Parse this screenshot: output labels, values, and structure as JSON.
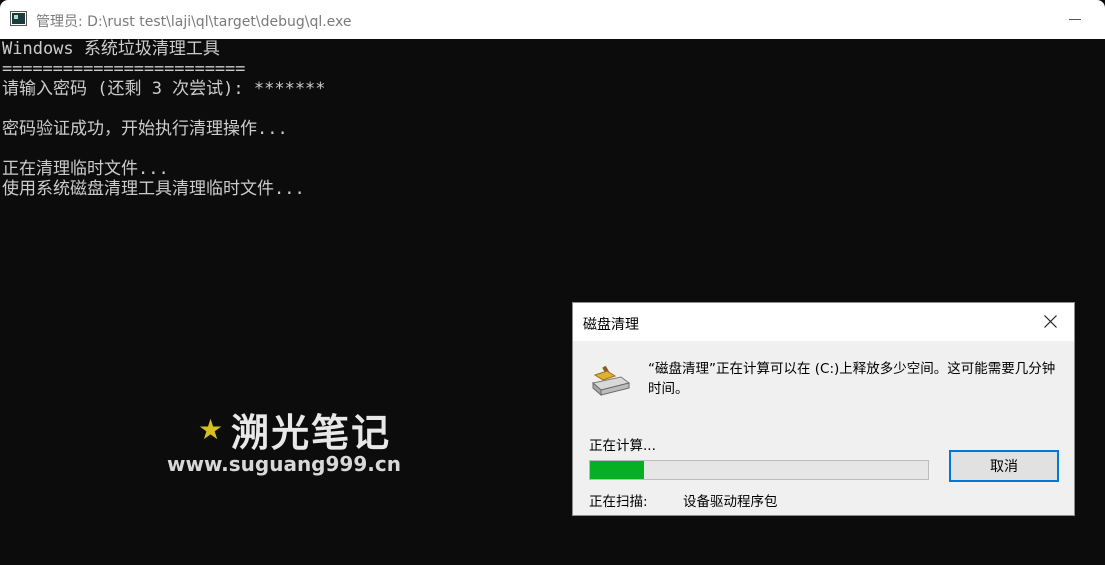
{
  "window": {
    "title": "管理员: D:\\rust test\\laji\\ql\\target\\debug\\ql.exe"
  },
  "console": {
    "lines": [
      "Windows 系统垃圾清理工具",
      "========================",
      "请输入密码 (还剩 3 次尝试): *******",
      "",
      "密码验证成功，开始执行清理操作...",
      "",
      "正在清理临时文件...",
      "使用系统磁盘清理工具清理临时文件..."
    ]
  },
  "watermark": {
    "name": "溯光笔记",
    "url": "www.suguang999.cn"
  },
  "dialog": {
    "title": "磁盘清理",
    "message": "“磁盘清理”正在计算可以在 (C:)上释放多少空间。这可能需要几分钟时间。",
    "calc_label": "正在计算...",
    "progress": 0.16,
    "cancel_label": "取消",
    "scan_label": "正在扫描:",
    "scan_value": "设备驱动程序包"
  },
  "colors": {
    "console_bg": "#0c0c0c",
    "console_text": "#cccccc",
    "progress_green": "#06b025",
    "focus_blue": "#0078d7",
    "watermark_star": "#d6c020"
  },
  "icons": {
    "window": "console-window-icon",
    "minimize": "minimize-icon",
    "close": "close-icon",
    "dialog": "disk-cleanup-icon",
    "watermark": "star-icon"
  }
}
